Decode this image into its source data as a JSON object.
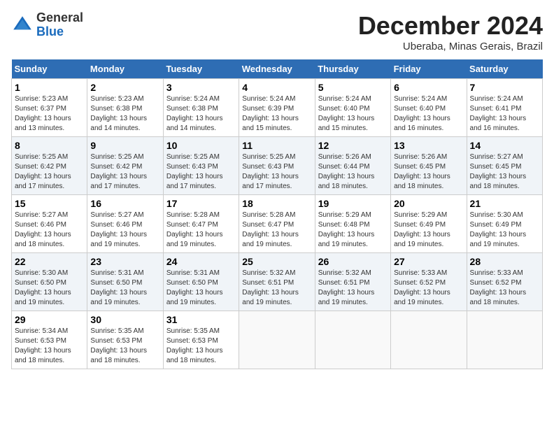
{
  "header": {
    "logo_general": "General",
    "logo_blue": "Blue",
    "month_title": "December 2024",
    "location": "Uberaba, Minas Gerais, Brazil"
  },
  "days_of_week": [
    "Sunday",
    "Monday",
    "Tuesday",
    "Wednesday",
    "Thursday",
    "Friday",
    "Saturday"
  ],
  "weeks": [
    [
      {
        "day": "1",
        "sunrise": "5:23 AM",
        "sunset": "6:37 PM",
        "daylight": "13 hours and 13 minutes."
      },
      {
        "day": "2",
        "sunrise": "5:23 AM",
        "sunset": "6:38 PM",
        "daylight": "13 hours and 14 minutes."
      },
      {
        "day": "3",
        "sunrise": "5:24 AM",
        "sunset": "6:38 PM",
        "daylight": "13 hours and 14 minutes."
      },
      {
        "day": "4",
        "sunrise": "5:24 AM",
        "sunset": "6:39 PM",
        "daylight": "13 hours and 15 minutes."
      },
      {
        "day": "5",
        "sunrise": "5:24 AM",
        "sunset": "6:40 PM",
        "daylight": "13 hours and 15 minutes."
      },
      {
        "day": "6",
        "sunrise": "5:24 AM",
        "sunset": "6:40 PM",
        "daylight": "13 hours and 16 minutes."
      },
      {
        "day": "7",
        "sunrise": "5:24 AM",
        "sunset": "6:41 PM",
        "daylight": "13 hours and 16 minutes."
      }
    ],
    [
      {
        "day": "8",
        "sunrise": "5:25 AM",
        "sunset": "6:42 PM",
        "daylight": "13 hours and 17 minutes."
      },
      {
        "day": "9",
        "sunrise": "5:25 AM",
        "sunset": "6:42 PM",
        "daylight": "13 hours and 17 minutes."
      },
      {
        "day": "10",
        "sunrise": "5:25 AM",
        "sunset": "6:43 PM",
        "daylight": "13 hours and 17 minutes."
      },
      {
        "day": "11",
        "sunrise": "5:25 AM",
        "sunset": "6:43 PM",
        "daylight": "13 hours and 17 minutes."
      },
      {
        "day": "12",
        "sunrise": "5:26 AM",
        "sunset": "6:44 PM",
        "daylight": "13 hours and 18 minutes."
      },
      {
        "day": "13",
        "sunrise": "5:26 AM",
        "sunset": "6:45 PM",
        "daylight": "13 hours and 18 minutes."
      },
      {
        "day": "14",
        "sunrise": "5:27 AM",
        "sunset": "6:45 PM",
        "daylight": "13 hours and 18 minutes."
      }
    ],
    [
      {
        "day": "15",
        "sunrise": "5:27 AM",
        "sunset": "6:46 PM",
        "daylight": "13 hours and 18 minutes."
      },
      {
        "day": "16",
        "sunrise": "5:27 AM",
        "sunset": "6:46 PM",
        "daylight": "13 hours and 19 minutes."
      },
      {
        "day": "17",
        "sunrise": "5:28 AM",
        "sunset": "6:47 PM",
        "daylight": "13 hours and 19 minutes."
      },
      {
        "day": "18",
        "sunrise": "5:28 AM",
        "sunset": "6:47 PM",
        "daylight": "13 hours and 19 minutes."
      },
      {
        "day": "19",
        "sunrise": "5:29 AM",
        "sunset": "6:48 PM",
        "daylight": "13 hours and 19 minutes."
      },
      {
        "day": "20",
        "sunrise": "5:29 AM",
        "sunset": "6:49 PM",
        "daylight": "13 hours and 19 minutes."
      },
      {
        "day": "21",
        "sunrise": "5:30 AM",
        "sunset": "6:49 PM",
        "daylight": "13 hours and 19 minutes."
      }
    ],
    [
      {
        "day": "22",
        "sunrise": "5:30 AM",
        "sunset": "6:50 PM",
        "daylight": "13 hours and 19 minutes."
      },
      {
        "day": "23",
        "sunrise": "5:31 AM",
        "sunset": "6:50 PM",
        "daylight": "13 hours and 19 minutes."
      },
      {
        "day": "24",
        "sunrise": "5:31 AM",
        "sunset": "6:50 PM",
        "daylight": "13 hours and 19 minutes."
      },
      {
        "day": "25",
        "sunrise": "5:32 AM",
        "sunset": "6:51 PM",
        "daylight": "13 hours and 19 minutes."
      },
      {
        "day": "26",
        "sunrise": "5:32 AM",
        "sunset": "6:51 PM",
        "daylight": "13 hours and 19 minutes."
      },
      {
        "day": "27",
        "sunrise": "5:33 AM",
        "sunset": "6:52 PM",
        "daylight": "13 hours and 19 minutes."
      },
      {
        "day": "28",
        "sunrise": "5:33 AM",
        "sunset": "6:52 PM",
        "daylight": "13 hours and 18 minutes."
      }
    ],
    [
      {
        "day": "29",
        "sunrise": "5:34 AM",
        "sunset": "6:53 PM",
        "daylight": "13 hours and 18 minutes."
      },
      {
        "day": "30",
        "sunrise": "5:35 AM",
        "sunset": "6:53 PM",
        "daylight": "13 hours and 18 minutes."
      },
      {
        "day": "31",
        "sunrise": "5:35 AM",
        "sunset": "6:53 PM",
        "daylight": "13 hours and 18 minutes."
      },
      null,
      null,
      null,
      null
    ]
  ]
}
